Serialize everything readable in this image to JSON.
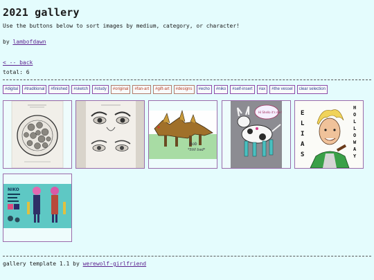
{
  "page": {
    "title": "2021 gallery",
    "intro": "Use the buttons below to sort images by medium, category, or character!",
    "by_prefix": "by ",
    "author": "lambofdawn",
    "back_link": "< -- back",
    "total": "total: 6"
  },
  "filters": [
    {
      "label": "#digital",
      "style": "blue"
    },
    {
      "label": "#traditional",
      "style": "blue"
    },
    {
      "label": "#finished",
      "style": "blue"
    },
    {
      "label": "#sketch",
      "style": "blue"
    },
    {
      "label": "#study",
      "style": "blue"
    },
    {
      "label": "#original",
      "style": "red"
    },
    {
      "label": "#fan-art",
      "style": "red"
    },
    {
      "label": "#gift-art",
      "style": "red"
    },
    {
      "label": "#designs",
      "style": "red"
    },
    {
      "label": "#echo",
      "style": "blue"
    },
    {
      "label": "#niko",
      "style": "blue"
    },
    {
      "label": "#self-insert",
      "style": "blue"
    },
    {
      "label": "#ax",
      "style": "blue"
    },
    {
      "label": "#the vessel",
      "style": "blue"
    },
    {
      "label": "clear selection",
      "style": "blue"
    }
  ],
  "gallery": {
    "items": [
      {
        "name": "sketch-plate-drawing"
      },
      {
        "name": "eye-studies-drawing"
      },
      {
        "name": "bob-creature-drawing",
        "caption": "Bob",
        "caption2": "*Still bad*"
      },
      {
        "name": "goat-creature-drawing",
        "caption": "Hi Shello it's me!"
      },
      {
        "name": "elias-holloway-drawing",
        "left_text": "ELIAS",
        "right_text": "HOLLOWAY"
      },
      {
        "name": "character-reference-sheet",
        "caption": "NIKO"
      }
    ]
  },
  "footer": {
    "prefix": "gallery template 1.1 by ",
    "author": "werewolf-girlfriend"
  },
  "colors": {
    "background": "#e4fcfd",
    "link": "#5b1f8e",
    "tag_blue": "#2c3e8e",
    "tag_red": "#b8432a"
  }
}
